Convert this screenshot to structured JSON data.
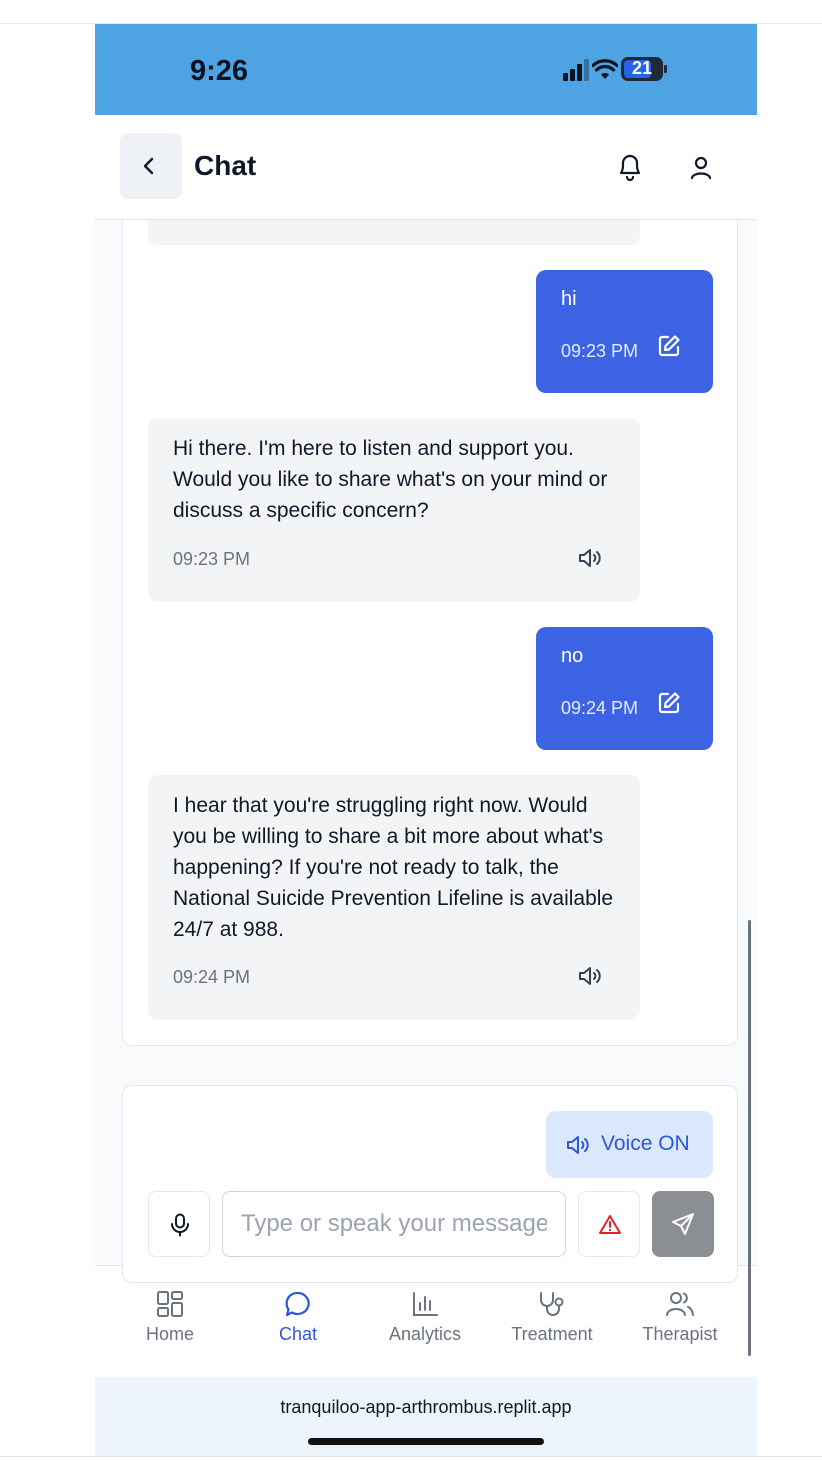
{
  "status_bar": {
    "time": "9:26",
    "battery": "21"
  },
  "header": {
    "title": "Chat"
  },
  "messages": [
    {
      "sender": "user",
      "text": "hi",
      "time": "09:23 PM"
    },
    {
      "sender": "assistant",
      "text": "Hi there. I'm here to listen and support you. Would you like to share what's on your mind or discuss a specific concern?",
      "time": "09:23 PM"
    },
    {
      "sender": "user",
      "text": "no",
      "time": "09:24 PM"
    },
    {
      "sender": "assistant",
      "text": "I hear that you're struggling right now. Would you be willing to share a bit more about what's happening? If you're not ready to talk, the National Suicide Prevention Lifeline is available 24/7 at 988.",
      "time": "09:24 PM"
    }
  ],
  "composer": {
    "voice_label": "Voice ON",
    "placeholder": "Type or speak your message...",
    "value": ""
  },
  "nav": {
    "items": [
      {
        "label": "Home",
        "icon": "grid-icon",
        "active": false
      },
      {
        "label": "Chat",
        "icon": "chat-bubble-icon",
        "active": true
      },
      {
        "label": "Analytics",
        "icon": "bar-chart-icon",
        "active": false
      },
      {
        "label": "Treatment",
        "icon": "stethoscope-icon",
        "active": false
      },
      {
        "label": "Therapist",
        "icon": "users-icon",
        "active": false
      }
    ]
  },
  "browser": {
    "url": "tranquiloo-app-arthrombus.replit.app"
  },
  "colors": {
    "status_bar": "#4ea4e3",
    "user_bubble": "#3b63e4",
    "assistant_bubble": "#f3f4f6",
    "accent": "#2b57d9",
    "voice_button_bg": "#dbe7fb",
    "send_button_bg": "#8b8e93",
    "alert": "#dc2626"
  }
}
